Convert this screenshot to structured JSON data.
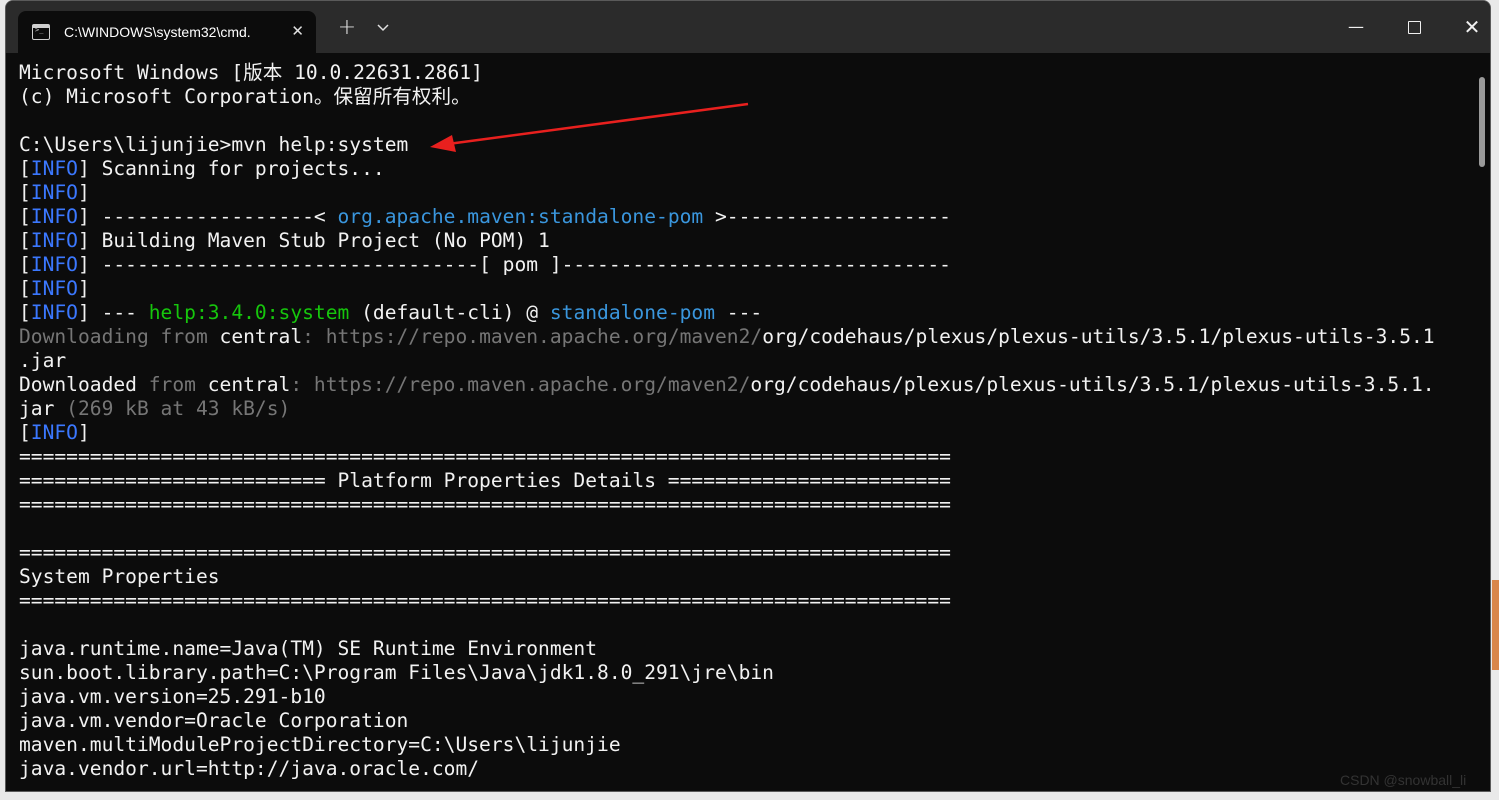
{
  "window": {
    "tab_title": "C:\\WINDOWS\\system32\\cmd.",
    "new_tab_label": "+",
    "dropdown_icon": "chevron-down-icon",
    "minimize_label": "—",
    "close_label": "✕"
  },
  "terminal_lines": [
    [
      {
        "t": "Microsoft Windows [版本 10.0.22631.2861]",
        "c": "w"
      }
    ],
    [
      {
        "t": "(c) Microsoft Corporation。保留所有权利。",
        "c": "w"
      }
    ],
    [],
    [
      {
        "t": "C:\\Users\\lijunjie>mvn help:system",
        "c": "w"
      }
    ],
    [
      {
        "t": "[",
        "c": "w"
      },
      {
        "t": "INFO",
        "c": "info"
      },
      {
        "t": "] Scanning for projects...",
        "c": "w"
      }
    ],
    [
      {
        "t": "[",
        "c": "w"
      },
      {
        "t": "INFO",
        "c": "info"
      },
      {
        "t": "]",
        "c": "w"
      }
    ],
    [
      {
        "t": "[",
        "c": "w"
      },
      {
        "t": "INFO",
        "c": "info"
      },
      {
        "t": "] ------------------< ",
        "c": "w"
      },
      {
        "t": "org.apache.maven:standalone-pom",
        "c": "blue"
      },
      {
        "t": " >-------------------",
        "c": "w"
      }
    ],
    [
      {
        "t": "[",
        "c": "w"
      },
      {
        "t": "INFO",
        "c": "info"
      },
      {
        "t": "] Building Maven Stub Project (No POM) 1",
        "c": "w"
      }
    ],
    [
      {
        "t": "[",
        "c": "w"
      },
      {
        "t": "INFO",
        "c": "info"
      },
      {
        "t": "] --------------------------------[ pom ]---------------------------------",
        "c": "w"
      }
    ],
    [
      {
        "t": "[",
        "c": "w"
      },
      {
        "t": "INFO",
        "c": "info"
      },
      {
        "t": "]",
        "c": "w"
      }
    ],
    [
      {
        "t": "[",
        "c": "w"
      },
      {
        "t": "INFO",
        "c": "info"
      },
      {
        "t": "] --- ",
        "c": "w"
      },
      {
        "t": "help:3.4.0:system",
        "c": "green"
      },
      {
        "t": " (default-cli) @ ",
        "c": "w"
      },
      {
        "t": "standalone-pom",
        "c": "blue"
      },
      {
        "t": " ---",
        "c": "w"
      }
    ],
    [
      {
        "t": "Downloading from ",
        "c": "grey"
      },
      {
        "t": "central",
        "c": "w"
      },
      {
        "t": ": https://repo.maven.apache.org/maven2/",
        "c": "grey"
      },
      {
        "t": "org/codehaus/plexus/plexus-utils/3.5.1/plexus-utils-3.5.1",
        "c": "w"
      }
    ],
    [
      {
        "t": ".jar",
        "c": "w"
      }
    ],
    [
      {
        "t": "Downloaded ",
        "c": "w"
      },
      {
        "t": "from ",
        "c": "grey"
      },
      {
        "t": "central",
        "c": "w"
      },
      {
        "t": ": https://repo.maven.apache.org/maven2/",
        "c": "grey"
      },
      {
        "t": "org/codehaus/plexus/plexus-utils/3.5.1/plexus-utils-3.5.1.",
        "c": "w"
      }
    ],
    [
      {
        "t": "jar",
        "c": "w"
      },
      {
        "t": " (269 kB at 43 kB/s)",
        "c": "grey"
      }
    ],
    [
      {
        "t": "[",
        "c": "w"
      },
      {
        "t": "INFO",
        "c": "info"
      },
      {
        "t": "]",
        "c": "w"
      }
    ],
    [
      {
        "t": "===============================================================================",
        "c": "w"
      }
    ],
    [
      {
        "t": "========================== Platform Properties Details ========================",
        "c": "w"
      }
    ],
    [
      {
        "t": "===============================================================================",
        "c": "w"
      }
    ],
    [],
    [
      {
        "t": "===============================================================================",
        "c": "w"
      }
    ],
    [
      {
        "t": "System Properties",
        "c": "w"
      }
    ],
    [
      {
        "t": "===============================================================================",
        "c": "w"
      }
    ],
    [],
    [
      {
        "t": "java.runtime.name=Java(TM) SE Runtime Environment",
        "c": "w"
      }
    ],
    [
      {
        "t": "sun.boot.library.path=C:\\Program Files\\Java\\jdk1.8.0_291\\jre\\bin",
        "c": "w"
      }
    ],
    [
      {
        "t": "java.vm.version=25.291-b10",
        "c": "w"
      }
    ],
    [
      {
        "t": "java.vm.vendor=Oracle Corporation",
        "c": "w"
      }
    ],
    [
      {
        "t": "maven.multiModuleProjectDirectory=C:\\Users\\lijunjie",
        "c": "w"
      }
    ],
    [
      {
        "t": "java.vendor.url=http://java.oracle.com/",
        "c": "w"
      }
    ]
  ],
  "watermark": "CSDN @snowball_li",
  "colors": {
    "background": "#0c0c0c",
    "text": "#f2f2f2",
    "info": "#3b78ff",
    "grey": "#767676",
    "green": "#16c60c",
    "blue": "#3a96dd",
    "annotation_arrow": "#e8201e"
  }
}
